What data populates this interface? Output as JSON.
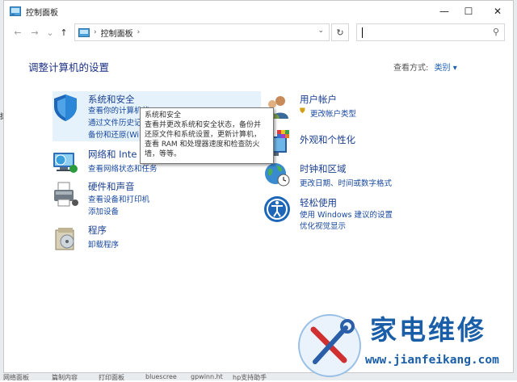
{
  "window": {
    "title": "控制面板",
    "minimize_label": "—",
    "maximize_label": "☐",
    "close_label": "✕"
  },
  "nav": {
    "back_label": "←",
    "forward_label": "→",
    "recent_label": "⌄",
    "up_label": "↑",
    "breadcrumb": [
      "控制面板"
    ],
    "breadcrumb_separator": "›",
    "address_dropdown_label": "⌄",
    "refresh_label": "↻",
    "search_placeholder": "",
    "search_icon_label": "⚲"
  },
  "main": {
    "heading": "调整计算机的设置",
    "view_by_label": "查看方式:",
    "view_by_value": "类别 ▾"
  },
  "categories_left": [
    {
      "title": "系统和安全",
      "links": [
        "查看你的计算机状",
        "通过文件历史记",
        "备份和还原(Wi"
      ]
    },
    {
      "title": "网络和 Inte",
      "links": [
        "查看网络状态和任务"
      ]
    },
    {
      "title": "硬件和声音",
      "links": [
        "查看设备和打印机",
        "添加设备"
      ]
    },
    {
      "title": "程序",
      "links": [
        "卸载程序"
      ]
    }
  ],
  "categories_right": [
    {
      "title": "用户帐户",
      "links": [
        "更改帐户类型"
      ]
    },
    {
      "title": "外观和个性化",
      "links": []
    },
    {
      "title": "时钟和区域",
      "links": [
        "更改日期、时间或数字格式"
      ]
    },
    {
      "title": "轻松使用",
      "links": [
        "使用 Windows 建议的设置",
        "优化视觉显示"
      ]
    }
  ],
  "tooltip": {
    "lines": [
      "系统和安全",
      "查看并更改系统和安全状态，备份并",
      "还原文件和系统设置，更新计算机，",
      "查看 RAM 和处理器速度和检查防火",
      "墙，等等。"
    ]
  },
  "watermark": {
    "title": "家电维修",
    "url": "www.jianfeikang.com"
  },
  "left_edge_clip": "捷",
  "taskbar_fragments": [
    "网络面板",
    "篇制内容",
    "打印面板",
    "bluescree",
    "gpwinn.ht",
    "hp支持助手"
  ],
  "colors": {
    "link": "#1a4aa0",
    "heading": "#1e3287",
    "highlight": "#e5f1fb",
    "brand": "#1a5ea8"
  }
}
